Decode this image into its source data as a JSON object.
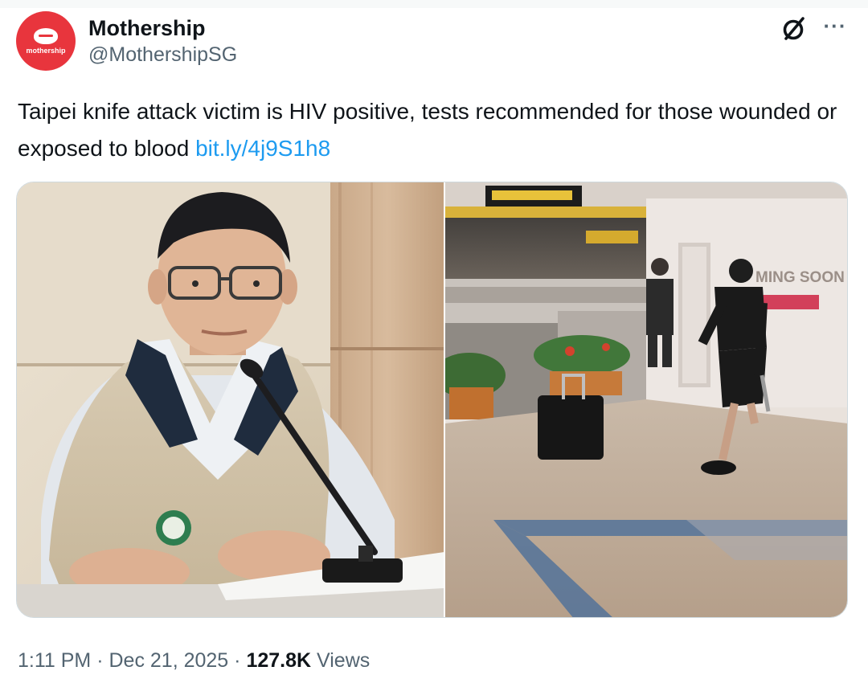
{
  "author": {
    "display_name": "Mothership",
    "handle": "@MothershipSG",
    "avatar_text": "mothership",
    "avatar_color": "#e8353d"
  },
  "header_icons": {
    "grok": "grok-icon",
    "more": "more-icon"
  },
  "tweet": {
    "text": "Taipei knife attack victim is HIV positive, tests recommended for those wounded or exposed to blood",
    "link": "bit.ly/4j9S1h8",
    "link_color": "#1d9bf0"
  },
  "media": {
    "photo_right_sign_text": "MING SOON"
  },
  "meta": {
    "time": "1:11 PM",
    "separator": "·",
    "date": "Dec 21, 2025",
    "views_count": "127.8K",
    "views_label": "Views"
  }
}
